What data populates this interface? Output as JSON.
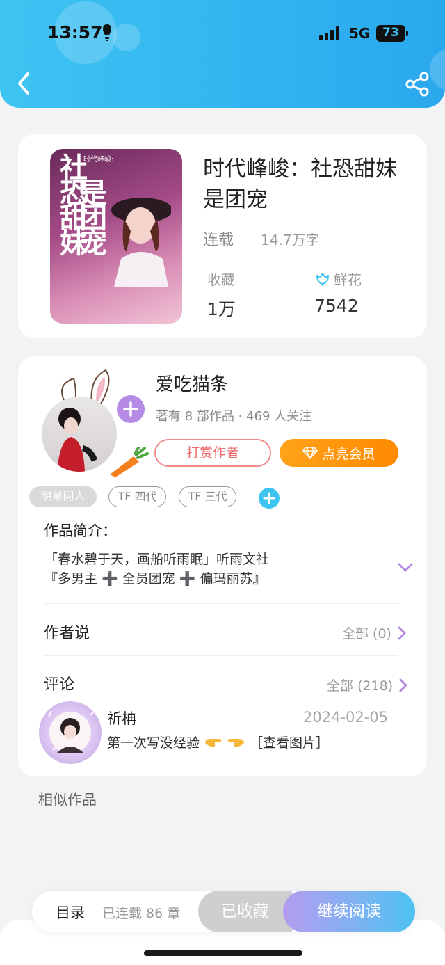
{
  "status": {
    "time": "13:57",
    "network": "5G",
    "battery": "73"
  },
  "book": {
    "title": "时代峰峻：社恐甜妹是团宠",
    "cover_title_a": "社恐甜妹",
    "cover_title_b": "是团宠",
    "cover_small": "时代峰峻:",
    "status": "连载",
    "word_count": "14.7万字",
    "favorites_label": "收藏",
    "favorites_value": "1万",
    "flowers_label": "鲜花",
    "flowers_value": "7542"
  },
  "author": {
    "name": "爱吃猫条",
    "info": "著有 8 部作品 · 469 人关注",
    "reward_label": "打赏作者",
    "vip_label": "点亮会员",
    "tags": [
      "明星同人",
      "TF 四代",
      "TF 三代"
    ]
  },
  "intro": {
    "title": "作品简介：",
    "line1": "「春水碧于天，画船听雨眠」听雨文社",
    "line2": "『多男主 ➕ 全员团宠 ➕ 偏玛丽苏』"
  },
  "author_says": {
    "title": "作者说",
    "link": "全部 (0)"
  },
  "comments": {
    "title": "评论",
    "link": "全部 (218)",
    "items": [
      {
        "user": "祈柟",
        "date": "2024-02-05",
        "text_a": "第一次写没经验",
        "text_b": "［查看图片］"
      }
    ]
  },
  "similar_title": "相似作品",
  "bottom_bar": {
    "catalog": "目录",
    "chapters": "已连载 86 章",
    "collected": "已收藏",
    "continue": "继续阅读"
  },
  "colors": {
    "accent": "#3ec4f2",
    "vip": "#ff8a00",
    "reward": "#ee6a6a",
    "purple": "#b49cf0"
  }
}
